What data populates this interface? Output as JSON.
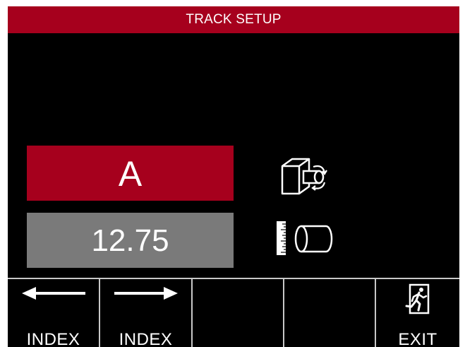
{
  "screen": {
    "title": "TRACK SETUP",
    "accent_color": "#a6001d",
    "value_box_color": "#7a7a7a"
  },
  "track": {
    "value": "A",
    "icon": "rotate-track-icon"
  },
  "length": {
    "value": "12.75",
    "icon": "ruler-cylinder-icon"
  },
  "softkeys": [
    {
      "label": "INDEX",
      "icon": "arrow-left-icon"
    },
    {
      "label": "INDEX",
      "icon": "arrow-right-icon"
    },
    {
      "label": "",
      "icon": ""
    },
    {
      "label": "",
      "icon": ""
    },
    {
      "label": "EXIT",
      "icon": "exit-icon"
    }
  ]
}
